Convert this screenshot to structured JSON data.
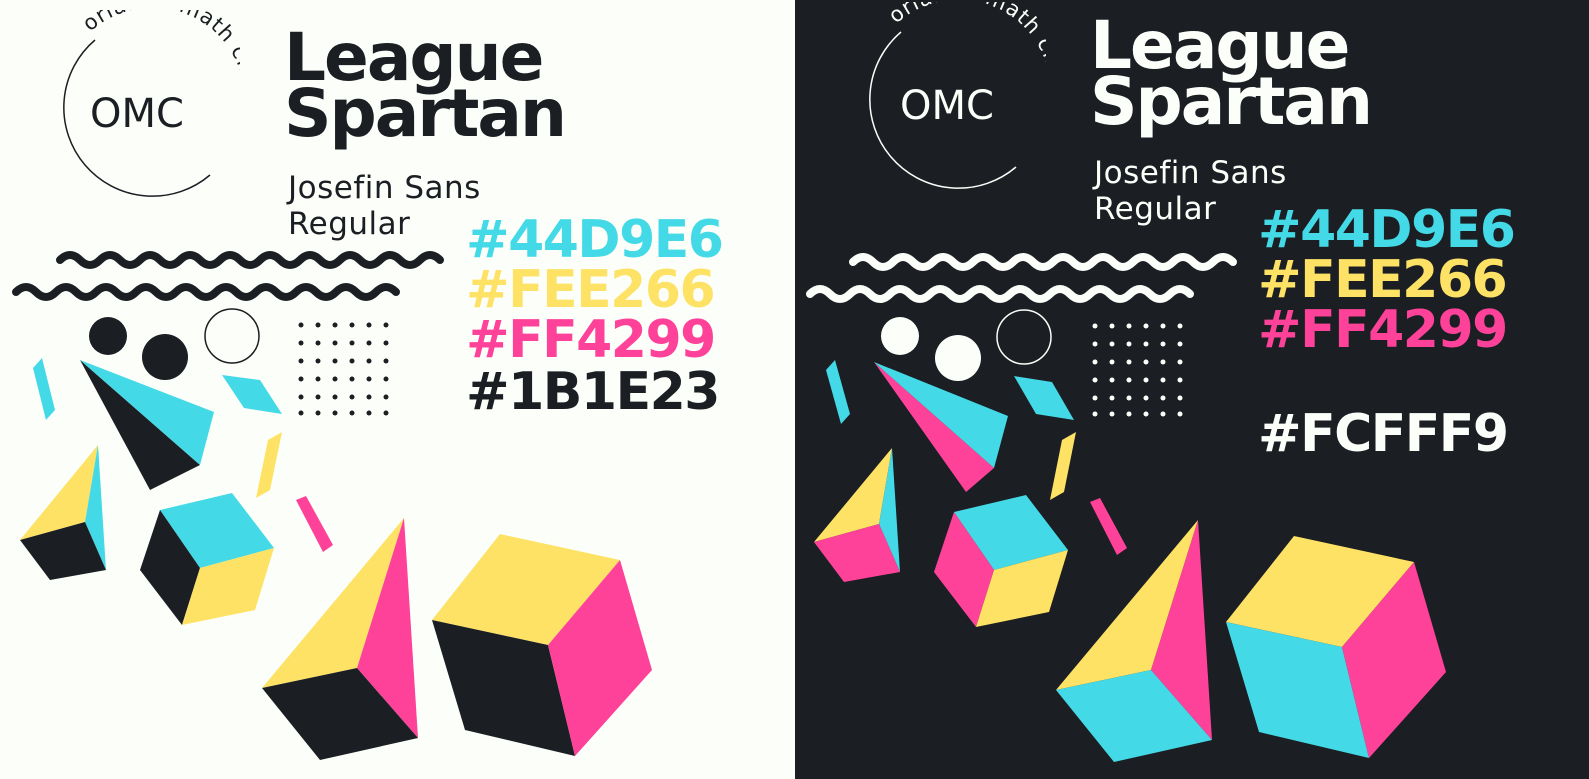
{
  "logo": {
    "abbreviation": "OMC",
    "arc_text": "orlando math circle"
  },
  "typography": {
    "heading_font": [
      "League",
      "Spartan"
    ],
    "body_font": [
      "Josefin Sans",
      "Regular"
    ]
  },
  "palette": {
    "cyan": "#44D9E6",
    "yellow": "#FEE266",
    "pink": "#FF4299",
    "dark": "#1B1E23",
    "light": "#FCFFF9"
  },
  "light_panel": {
    "swatches": [
      "#44D9E6",
      "#FEE266",
      "#FF4299",
      "#1B1E23"
    ]
  },
  "dark_panel": {
    "swatches": [
      "#44D9E6",
      "#FEE266",
      "#FF4299",
      "#FCFFF9"
    ]
  }
}
